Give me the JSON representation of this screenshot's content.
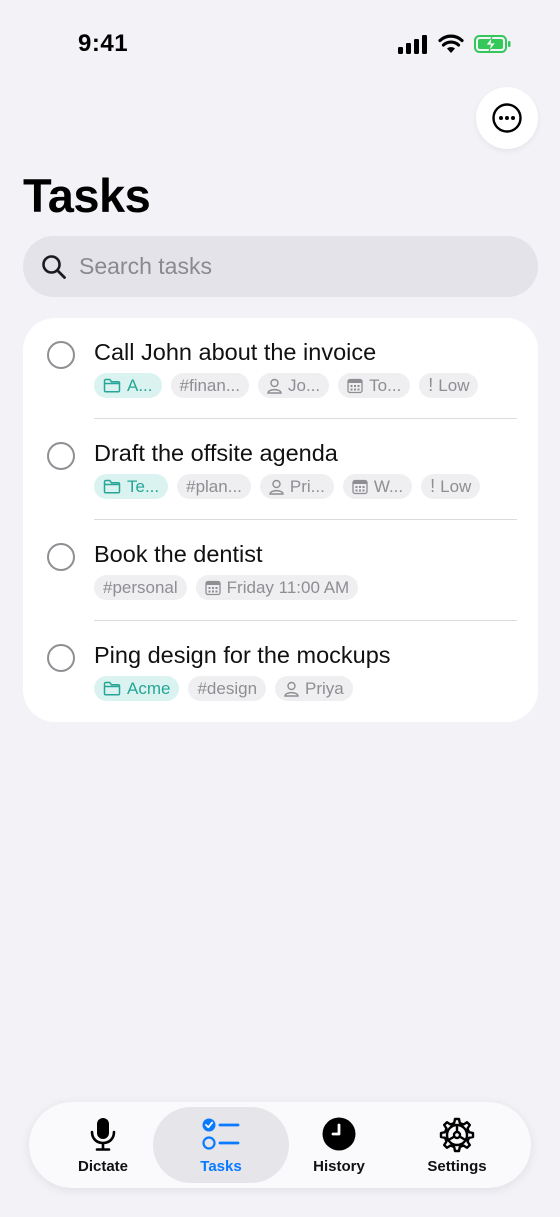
{
  "status_bar": {
    "time": "9:41"
  },
  "header": {
    "title": "Tasks"
  },
  "search": {
    "placeholder": "Search tasks"
  },
  "tasks": [
    {
      "title": "Call John about the invoice",
      "project": "A...",
      "tag": "#finan...",
      "person": "Jo...",
      "date": "To...",
      "priority": "Low"
    },
    {
      "title": "Draft the offsite agenda",
      "project": "Te...",
      "tag": "#plan...",
      "person": "Pri...",
      "date": "W...",
      "priority": "Low"
    },
    {
      "title": "Book the dentist",
      "tag": "#personal",
      "date": "Friday 11:00 AM"
    },
    {
      "title": "Ping design for the mockups",
      "project": "Acme",
      "tag": "#design",
      "person": "Priya"
    }
  ],
  "tab_bar": {
    "items": [
      {
        "label": "Dictate",
        "icon": "mic-icon"
      },
      {
        "label": "Tasks",
        "icon": "checklist-icon",
        "active": true
      },
      {
        "label": "History",
        "icon": "clock-icon"
      },
      {
        "label": "Settings",
        "icon": "gear-icon"
      }
    ]
  },
  "colors": {
    "accent": "#0a7aff",
    "project_tag_text": "#27a597",
    "project_tag_bg": "#daf3f0",
    "battery": "#34c759"
  }
}
